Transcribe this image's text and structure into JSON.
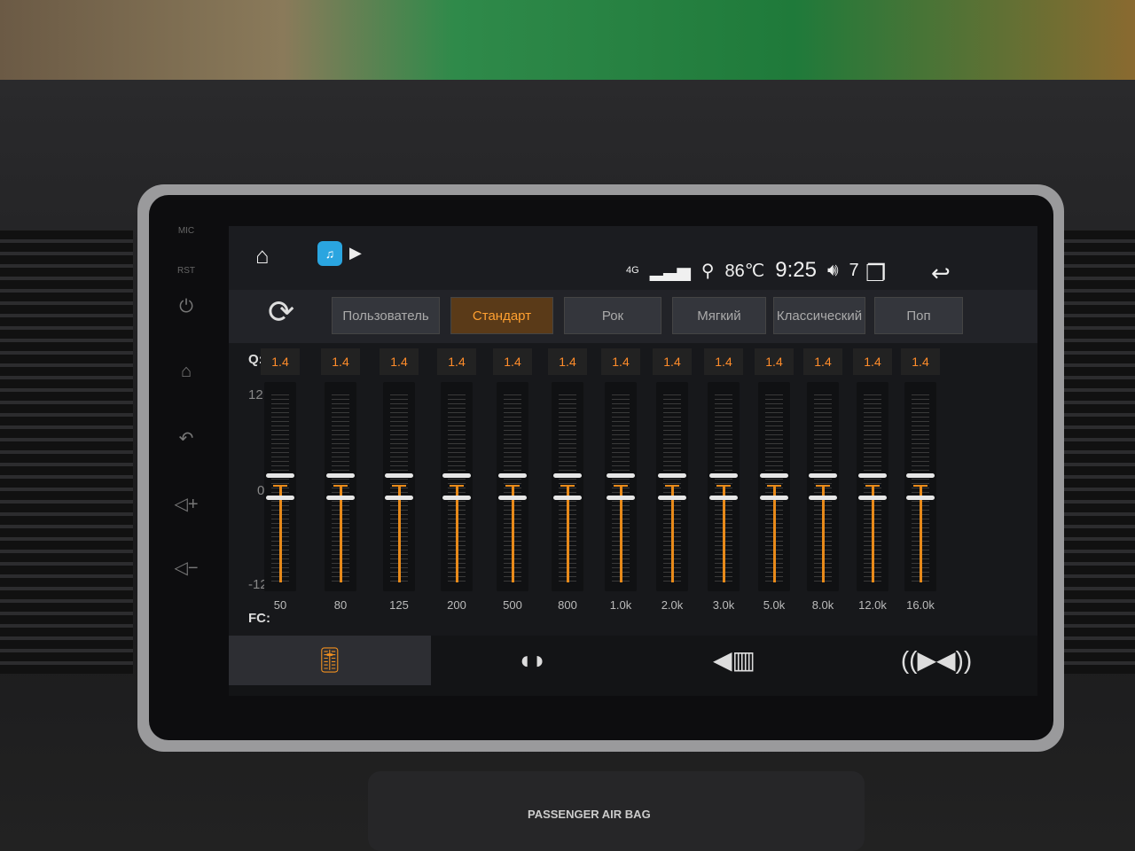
{
  "side_panel": {
    "mic_label": "MIC",
    "rst_label": "RST"
  },
  "status_bar": {
    "network": "4G",
    "temperature": "86℃",
    "time": "9:25",
    "volume": "7"
  },
  "presets": {
    "items": [
      {
        "label": "Пользователь",
        "active": false
      },
      {
        "label": "Стандарт",
        "active": true
      },
      {
        "label": "Рок",
        "active": false
      },
      {
        "label": "Мягкий",
        "active": false
      },
      {
        "label": "Классический",
        "active": false
      },
      {
        "label": "Поп",
        "active": false
      }
    ]
  },
  "eq": {
    "q_label": "Q:",
    "fc_label": "FC:",
    "scale": {
      "max": "12",
      "mid": "0",
      "min": "-12"
    },
    "bands": [
      {
        "fc": "50",
        "q": "1.4",
        "gain": 0
      },
      {
        "fc": "80",
        "q": "1.4",
        "gain": 0
      },
      {
        "fc": "125",
        "q": "1.4",
        "gain": 0
      },
      {
        "fc": "200",
        "q": "1.4",
        "gain": 0
      },
      {
        "fc": "500",
        "q": "1.4",
        "gain": 0
      },
      {
        "fc": "800",
        "q": "1.4",
        "gain": 0
      },
      {
        "fc": "1.0k",
        "q": "1.4",
        "gain": 0
      },
      {
        "fc": "2.0k",
        "q": "1.4",
        "gain": 0
      },
      {
        "fc": "3.0k",
        "q": "1.4",
        "gain": 0
      },
      {
        "fc": "5.0k",
        "q": "1.4",
        "gain": 0
      },
      {
        "fc": "8.0k",
        "q": "1.4",
        "gain": 0
      },
      {
        "fc": "12.0k",
        "q": "1.4",
        "gain": 0
      },
      {
        "fc": "16.0k",
        "q": "1.4",
        "gain": 0
      }
    ],
    "accent": "#e88a1a"
  },
  "bottom_tabs": [
    {
      "icon": "equalizer-icon",
      "active": true
    },
    {
      "icon": "sound-field-icon",
      "active": false
    },
    {
      "icon": "speaker-level-icon",
      "active": false
    },
    {
      "icon": "balance-speakers-icon",
      "active": false
    }
  ],
  "dashboard": {
    "airbag_label": "PASSENGER AIR BAG"
  }
}
